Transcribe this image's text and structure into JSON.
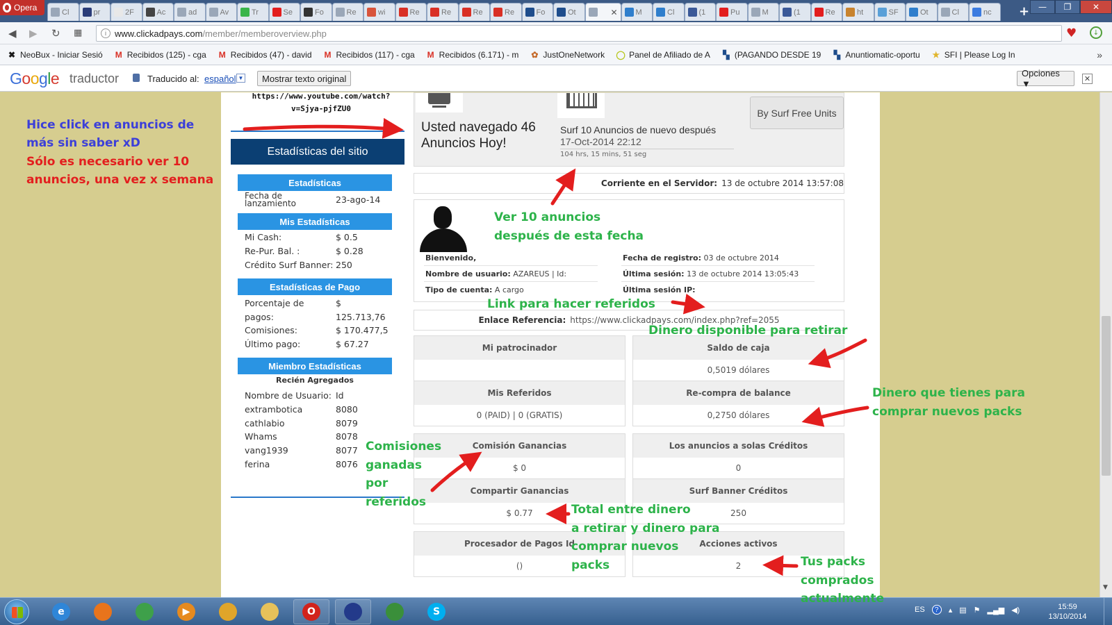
{
  "browser": {
    "opera_label": "Opera",
    "tabs": [
      {
        "label": "Cl",
        "color": "#9aa7b8"
      },
      {
        "label": "pr",
        "color": "#2a3c78"
      },
      {
        "label": "2F",
        "color": "#e8e8e8"
      },
      {
        "label": "Ac",
        "color": "#444444"
      },
      {
        "label": "ad",
        "color": "#9aa7b8"
      },
      {
        "label": "Av",
        "color": "#9aa7b8"
      },
      {
        "label": "Tr",
        "color": "#39b54a"
      },
      {
        "label": "Se",
        "color": "#e31e1e"
      },
      {
        "label": "Fo",
        "color": "#333333"
      },
      {
        "label": "Re",
        "color": "#9aa7b8"
      },
      {
        "label": "wi",
        "color": "#d8543b"
      },
      {
        "label": "Re",
        "color": "#d93025"
      },
      {
        "label": "Re",
        "color": "#d93025"
      },
      {
        "label": "Re",
        "color": "#d93025"
      },
      {
        "label": "Re",
        "color": "#d93025"
      },
      {
        "label": "Fo",
        "color": "#1e4d8c"
      },
      {
        "label": "Ot",
        "color": "#1e4d8c"
      },
      {
        "label": "",
        "color": "#9aa7b8",
        "active": true
      },
      {
        "label": "M",
        "color": "#2f7ecc"
      },
      {
        "label": "Cl",
        "color": "#2f7ecc"
      },
      {
        "label": "(1",
        "color": "#3b5998"
      },
      {
        "label": "Pu",
        "color": "#e31e1e"
      },
      {
        "label": "M",
        "color": "#9aa7b8"
      },
      {
        "label": "(1",
        "color": "#3b5998"
      },
      {
        "label": "Re",
        "color": "#e31e1e"
      },
      {
        "label": "ht",
        "color": "#c8832e"
      },
      {
        "label": "SF",
        "color": "#5aa0d8"
      },
      {
        "label": "Ot",
        "color": "#2f7ecc"
      },
      {
        "label": "Cl",
        "color": "#9aa7b8"
      },
      {
        "label": "nc",
        "color": "#3b7be0"
      }
    ],
    "new_tab": "+",
    "url_host": "www.clickadpays.com",
    "url_path": "/member/memberoverview.php",
    "bookmarks": [
      {
        "label": "NeoBux - Iniciar Sesió",
        "icon": "neobux-x-icon",
        "color": "#1a1a1a"
      },
      {
        "label": "Recibidos (125) - cga",
        "icon": "gmail-icon",
        "color": "#d93025"
      },
      {
        "label": "Recibidos (47) - david",
        "icon": "gmail-icon",
        "color": "#d93025"
      },
      {
        "label": "Recibidos (117) - cga",
        "icon": "gmail-icon",
        "color": "#d93025"
      },
      {
        "label": "Recibidos (6.171) - m",
        "icon": "gmail-icon",
        "color": "#d93025"
      },
      {
        "label": "JustOneNetwork",
        "icon": "flower-icon",
        "color": "#c56a2a"
      },
      {
        "label": "Panel de Afiliado de A",
        "icon": "circle-icon",
        "color": "#b6c61c"
      },
      {
        "label": "(PAGANDO DESDE 19",
        "icon": "square-logo-icon",
        "color": "#1e4d8c"
      },
      {
        "label": "Anuntiomatic-oportu",
        "icon": "square-logo-icon",
        "color": "#1e4d8c"
      },
      {
        "label": "SFI | Please Log In",
        "icon": "star-icon",
        "color": "#e0b52b"
      }
    ]
  },
  "translate": {
    "logo": "Google",
    "product": "traductor",
    "translated_to": "Traducido al:",
    "language": "español",
    "show_original": "Mostrar texto original",
    "options": "Opciones ▼"
  },
  "sidebar": {
    "video_link": "https://www.youtube.com/watch?v=Sjya-pjfZU0",
    "header": "Estadísticas del sitio",
    "sections": {
      "stats_title": "Estadísticas",
      "launch_label": "Fecha de lanzamiento",
      "launch_value": "23-ago-14",
      "my_stats_title": "Mis Estadísticas",
      "cash_label": "Mi Cash:",
      "cash_value": "$ 0.5",
      "repur_label": "Re-Pur. Bal. :",
      "repur_value": "$ 0.28",
      "banner_label": "Crédito Surf Banner:",
      "banner_value": "250",
      "pay_title": "Estadísticas de Pago",
      "percent_label": "Porcentaje de pagos:",
      "percent_value": "$ 125.713,76",
      "commissions_label": "Comisiones:",
      "commissions_value": "$ 170.477,5",
      "last_pay_label": "Último pago:",
      "last_pay_value": "$ 67.27",
      "members_title": "Miembro Estadísticas",
      "recent_title": "Recién Agregados",
      "members_header": {
        "name": "Nombre de Usuario:",
        "id": "Id"
      },
      "members": [
        {
          "name": "extrambotica",
          "id": "8080"
        },
        {
          "name": "cathlabio",
          "id": "8079"
        },
        {
          "name": "Whams",
          "id": "8078"
        },
        {
          "name": "vang1939",
          "id": "8077"
        },
        {
          "name": "ferina",
          "id": "8076"
        }
      ]
    }
  },
  "surf": {
    "surfed_today": "Usted navegado 46 Anuncios Hoy!",
    "next_label": "Surf 10 Anuncios de nuevo después",
    "next_date": "17-Oct-2014 22:12",
    "next_countdown": "104 hrs, 15 mins, 51 seg",
    "by_surf_button": "By Surf Free Units"
  },
  "server": {
    "label": "Corriente en el Servidor:",
    "value": "13 de octubre 2014 13:57:08"
  },
  "profile": {
    "welcome": "Bienvenido,",
    "username_label": "Nombre de usuario:",
    "username_value": "AZAREUS | Id:",
    "account_label": "Tipo de cuenta:",
    "account_value": "A cargo",
    "reg_label": "Fecha de registro:",
    "reg_value": "03 de octubre 2014",
    "last_session_label": "Última sesión:",
    "last_session_value": "13 de octubre 2014 13:05:43",
    "last_ip_label": "Última sesión IP:"
  },
  "referral": {
    "label": "Enlace Referencia:",
    "url": "https://www.clickadpays.com/index.php?ref=2055"
  },
  "grid": [
    {
      "id": "sponsor",
      "label": "Mi patrocinador",
      "value": ""
    },
    {
      "id": "cash-balance",
      "label": "Saldo de caja",
      "value": "0,5019 dólares"
    },
    {
      "id": "referrals",
      "label": "Mis Referidos",
      "value": "0 (PAID) | 0 (GRATIS)"
    },
    {
      "id": "repurchase",
      "label": "Re-compra de balance",
      "value": "0,2750 dólares"
    },
    {
      "id": "commission",
      "label": "Comisión Ganancias",
      "value": "$ 0"
    },
    {
      "id": "solo-ads",
      "label": "Los anuncios a solas Créditos",
      "value": "0"
    },
    {
      "id": "share",
      "label": "Compartir Ganancias",
      "value": "$ 0.77"
    },
    {
      "id": "surf-banner",
      "label": "Surf Banner Créditos",
      "value": "250"
    },
    {
      "id": "processor",
      "label": "Procesador de Pagos Id",
      "value": "()"
    },
    {
      "id": "active-shares",
      "label": "Acciones activos",
      "value": "2"
    }
  ],
  "annotations": {
    "clicked_more_1": "Hice click en anuncios de",
    "clicked_more_2": "más sin saber xD",
    "only_needed_1": "Sólo es necesario ver 10",
    "only_needed_2": "anuncios, una vez x semana",
    "view_after_1": "Ver 10 anuncios",
    "view_after_2": "después de esta fecha",
    "ref_link": "Link para hacer referidos",
    "withdraw": "Dinero disponible para retirar",
    "packs_money_1": "Dinero que tienes para",
    "packs_money_2": "comprar nuevos packs",
    "comm_1": "Comisiones",
    "comm_2": "ganadas",
    "comm_3": "por",
    "comm_4": "referidos",
    "total_1": "Total entre dinero",
    "total_2": "a retirar y dinero para",
    "total_3": "comprar nuevos",
    "total_4": "packs",
    "packs_1": "Tus packs",
    "packs_2": "comprados",
    "packs_3": "actualmente",
    "colors": {
      "green": "#2db34a",
      "blue": "#3c3fd9",
      "red": "#e31e1e"
    }
  },
  "taskbar": {
    "apps": [
      {
        "name": "ie-icon",
        "color": "#2f86d8",
        "glyph": "e"
      },
      {
        "name": "firefox-icon",
        "color": "#e8741c",
        "glyph": ""
      },
      {
        "name": "chrome-icon",
        "color": "#3ea04a",
        "glyph": ""
      },
      {
        "name": "media-player-icon",
        "color": "#e68a1f",
        "glyph": "▶"
      },
      {
        "name": "puzzle-icon",
        "color": "#e0a52a",
        "glyph": ""
      },
      {
        "name": "folder-icon",
        "color": "#e6c15a",
        "glyph": ""
      },
      {
        "name": "opera-icon",
        "color": "#d2231c",
        "glyph": "O"
      },
      {
        "name": "chart-app-icon",
        "color": "#233a8a",
        "glyph": ""
      },
      {
        "name": "network-people-icon",
        "color": "#3a8f3a",
        "glyph": ""
      },
      {
        "name": "skype-icon",
        "color": "#00aff0",
        "glyph": "S"
      }
    ],
    "lang": "ES",
    "time": "15:59",
    "date": "13/10/2014"
  }
}
